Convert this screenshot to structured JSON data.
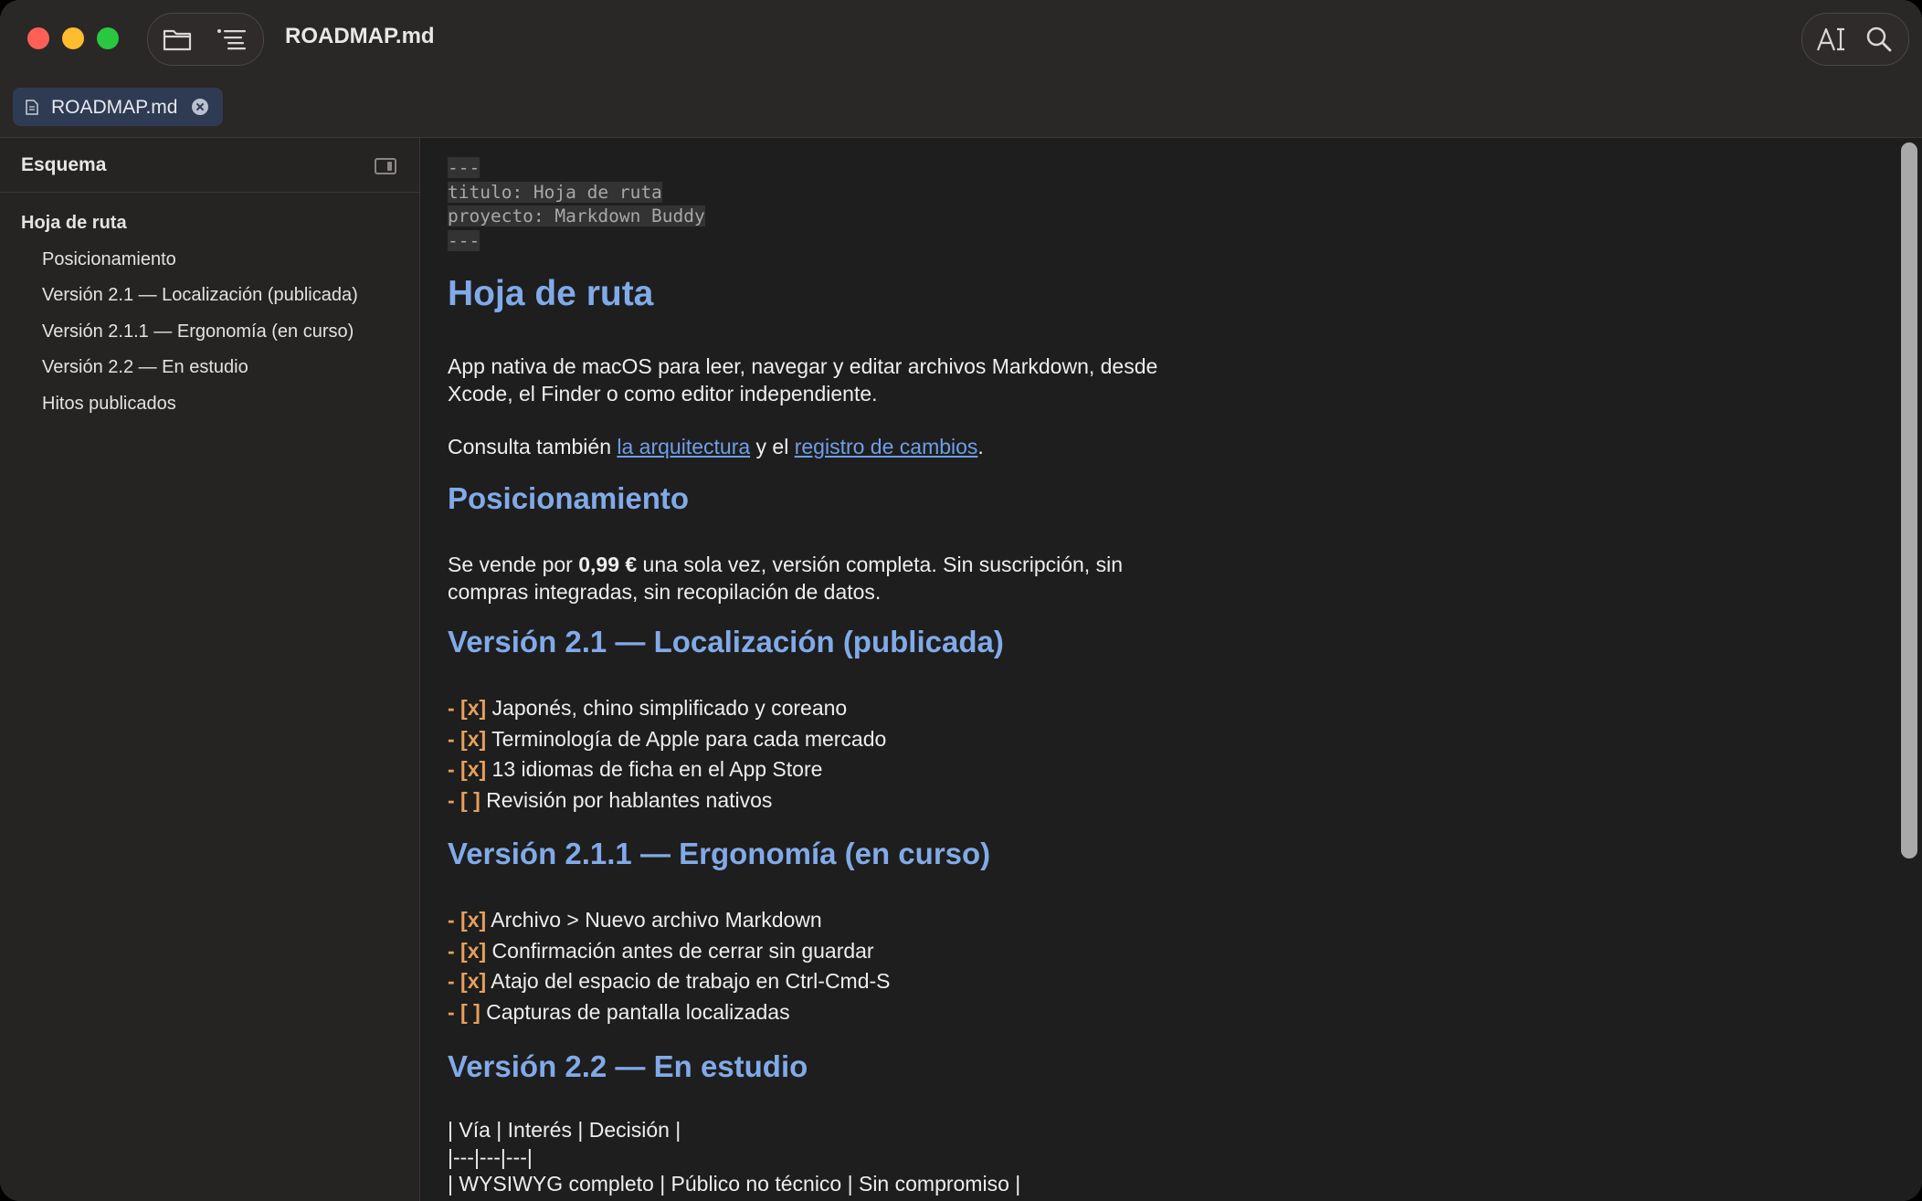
{
  "window": {
    "title": "ROADMAP.md"
  },
  "tabs": [
    {
      "label": "ROADMAP.md"
    }
  ],
  "sidebar": {
    "header": "Esquema",
    "items": [
      {
        "label": "Hoja de ruta",
        "level": 1
      },
      {
        "label": "Posicionamiento",
        "level": 2
      },
      {
        "label": "Versión 2.1 — Localización (publicada)",
        "level": 2
      },
      {
        "label": "Versión 2.1.1 — Ergonomía (en curso)",
        "level": 2
      },
      {
        "label": "Versión 2.2 — En estudio",
        "level": 2
      },
      {
        "label": "Hitos publicados",
        "level": 2
      }
    ]
  },
  "doc": {
    "frontmatter": [
      "---",
      "titulo: Hoja de ruta",
      "proyecto: Markdown Buddy",
      "---"
    ],
    "h1": "Hoja de ruta",
    "intro_line1": "App nativa de macOS para leer, navegar y editar archivos Markdown, desde",
    "intro_line2": "Xcode, el Finder o como editor independiente.",
    "see_prefix": "Consulta también ",
    "see_link1": "la arquitectura",
    "see_mid": " y el ",
    "see_link2": "registro de cambios",
    "see_suffix": ".",
    "pos_heading": "Posicionamiento",
    "pos_prefix": "Se vende por ",
    "pos_price": "0,99 €",
    "pos_line1_rest": " una sola vez, versión completa. Sin suscripción, sin",
    "pos_line2": "compras integradas, sin recopilación de datos.",
    "v21_heading": "Versión 2.1 — Localización (publicada)",
    "v21_items": [
      {
        "mark": "- [x]",
        "text": " Japonés, chino simplificado y coreano"
      },
      {
        "mark": "- [x]",
        "text": " Terminología de Apple para cada mercado"
      },
      {
        "mark": "- [x]",
        "text": " 13 idiomas de ficha en el App Store"
      },
      {
        "mark": "- [ ]",
        "text": " Revisión por hablantes nativos"
      }
    ],
    "v211_heading": "Versión 2.1.1 — Ergonomía (en curso)",
    "v211_items": [
      {
        "mark": "- [x]",
        "text": " Archivo > Nuevo archivo Markdown"
      },
      {
        "mark": "- [x]",
        "text": " Confirmación antes de cerrar sin guardar"
      },
      {
        "mark": "- [x]",
        "text": " Atajo del espacio de trabajo en Ctrl-Cmd-S"
      },
      {
        "mark": "- [ ]",
        "text": " Capturas de pantalla localizadas"
      }
    ],
    "v22_heading": "Versión 2.2 — En estudio",
    "table_lines": [
      "| Vía | Interés | Decisión |",
      "|---|---|---|",
      "| WYSIWYG completo | Público no técnico | Sin compromiso |"
    ]
  }
}
